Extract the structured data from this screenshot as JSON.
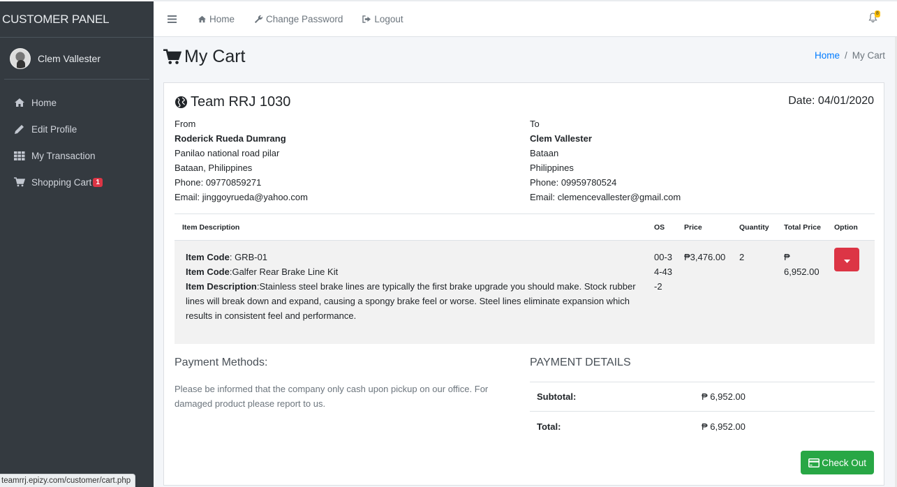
{
  "sidebar": {
    "brand": "CUSTOMER PANEL",
    "user_name": "Clem Vallester",
    "items": [
      {
        "label": "Home",
        "icon": "home-icon"
      },
      {
        "label": "Edit Profile",
        "icon": "pencil-icon"
      },
      {
        "label": "My Transaction",
        "icon": "grid-icon"
      },
      {
        "label": "Shopping Cart",
        "icon": "cart-icon",
        "badge": "1"
      }
    ]
  },
  "topbar": {
    "menu_icon": "hamburger-icon",
    "links": [
      {
        "label": "Home",
        "icon": "home-icon"
      },
      {
        "label": "Change Password",
        "icon": "wrench-icon"
      },
      {
        "label": "Logout",
        "icon": "sign-out-icon"
      }
    ],
    "notification_count": "8"
  },
  "header": {
    "title": "My Cart",
    "breadcrumb": [
      "Home",
      "My Cart"
    ]
  },
  "invoice": {
    "title": "Team RRJ 1030",
    "date": "Date: 04/01/2020",
    "from": {
      "label": "From",
      "name": "Roderick Rueda Dumrang",
      "line1": "Panilao national road pilar",
      "line2": "Bataan, Philippines",
      "phone": "Phone: 09770859271",
      "email": "Email: jinggoyrueda@yahoo.com"
    },
    "to": {
      "label": "To",
      "name": "Clem Vallester",
      "line1": "Bataan",
      "line2": "Philippines",
      "phone": "Phone: 09959780524",
      "email": "Email: clemencevallester@gmail.com"
    },
    "table": {
      "headers": [
        "Item Description",
        "OS",
        "Price",
        "Quantity",
        "Total Price",
        "Option"
      ],
      "rows": [
        {
          "code_label": "Item Code",
          "code": ": GRB-01",
          "name_label": "Item Code",
          "name": ":Galfer Rear Brake Line Kit",
          "desc_label": "Item Description",
          "desc": ":Stainless steel brake lines are typically the first brake upgrade you should make. Stock rubber lines will break down and expand, causing a spongy brake feel or worse. Steel lines eliminate expansion which results in consistent feel and performance.",
          "os": "00-34-43-2",
          "price": "₱3,476.00",
          "quantity": "2",
          "total": "₱ 6,952.00"
        }
      ]
    },
    "payment_methods": {
      "title": "Payment Methods:",
      "text": "Please be informed that the company only cash upon pickup on our office. For damaged product please report to us."
    },
    "payment_details": {
      "title": "PAYMENT DETAILS",
      "subtotal_label": "Subtotal:",
      "subtotal": "₱ 6,952.00",
      "total_label": "Total:",
      "total": "₱ 6,952.00"
    },
    "checkout_label": "Check Out"
  },
  "status_url": "teamrrj.epizy.com/customer/cart.php",
  "colors": {
    "sidebar_bg": "#343a40",
    "link": "#007bff",
    "danger": "#dc3545",
    "success": "#28a745",
    "warning": "#ffc107"
  }
}
